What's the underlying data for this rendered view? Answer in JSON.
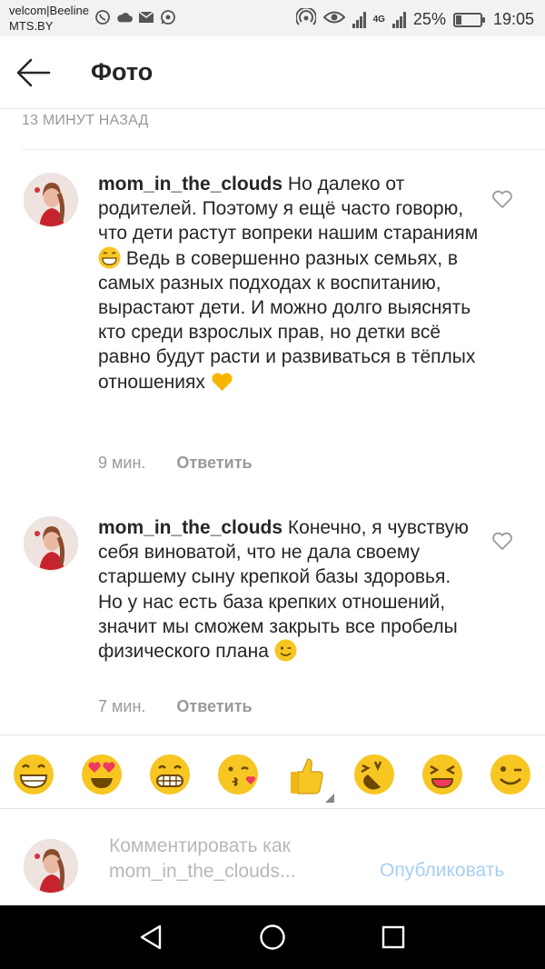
{
  "status_bar": {
    "carrier_line1": "velcom|Beeline",
    "carrier_line2": "MTS.BY",
    "left_icons": [
      "viber-icon",
      "cloud-icon",
      "mail-icon",
      "whatsapp-icon"
    ],
    "network": "4G",
    "battery_percent": "25%",
    "battery_level": 0.25,
    "time": "19:05"
  },
  "header": {
    "title": "Фото"
  },
  "top_timestamp": "13 МИНУТ НАЗАД",
  "comments": [
    {
      "username": "mom_in_the_clouds",
      "text_part1": "Но далеко от родителей. Поэтому я ещё часто говорю, что дети растут вопреки нашим стараниям",
      "emoji1": "grinning-face-emoji",
      "text_part2": "Ведь в совершенно разных семьях, в самых разных подходах к воспитанию, вырастают дети. И можно долго выяснять кто среди взрослых прав, но детки всё равно будут расти и развиваться в тёплых отношениях",
      "emoji2": "yellow-heart-emoji",
      "time": "9 мин.",
      "reply_label": "Ответить"
    },
    {
      "username": "mom_in_the_clouds",
      "text_part1": "Конечно, я чувствую себя виноватой, что не дала своему старшему сыну крепкой базы здоровья. Но у нас есть база крепких отношений, значит мы сможем закрыть все пробелы физического плана",
      "emoji1": "winking-face-emoji",
      "time": "7 мин.",
      "reply_label": "Ответить"
    }
  ],
  "emoji_bar": [
    "grinning-face",
    "heart-eyes",
    "grimacing-face",
    "kissing-face",
    "thumbs-up",
    "laughing-tilted-face",
    "squinting-face",
    "winking-face"
  ],
  "composer": {
    "placeholder_line1": "Комментировать как",
    "placeholder_line2": "mom_in_the_clouds...",
    "publish_label": "Опубликовать"
  },
  "colors": {
    "publish": "#a6d1f5",
    "emoji_yellow": "#f7c623",
    "muted": "#999999"
  }
}
